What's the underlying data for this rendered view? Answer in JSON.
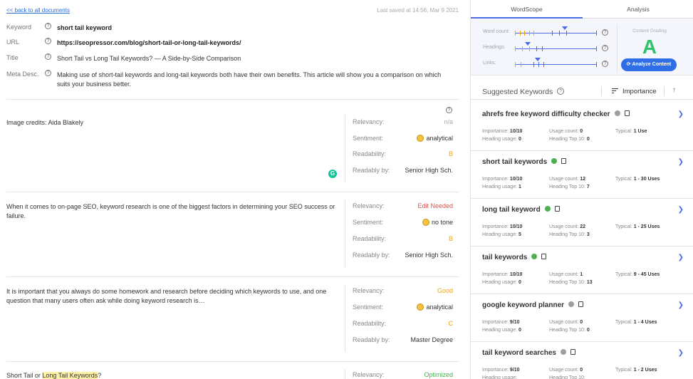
{
  "editor": {
    "back_link": "<< back to all documents",
    "last_saved": "Last saved at 14:56, Mar 9 2021",
    "fields": {
      "keyword": {
        "label": "Keyword",
        "value": "short tail keyword"
      },
      "url": {
        "label": "URL",
        "value": "https://seopressor.com/blog/short-tail-or-long-tail-keywords/"
      },
      "title": {
        "label": "Title",
        "value": "Short Tail vs Long Tail Keywords? — A Side-by-Side Comparison"
      },
      "meta": {
        "label": "Meta Desc.",
        "value": "Making use of short-tail keywords and long-tail keywords both have their own benefits. This article will show you a comparison on which suits your business better."
      }
    },
    "stat_labels": {
      "relevancy": "Relevancy:",
      "sentiment": "Sentiment:",
      "readability": "Readability:",
      "readably_by": "Readably by:"
    },
    "blocks": [
      {
        "text": "Image credits: Aida Blakely",
        "relevancy": "n/a",
        "sentiment": "analytical",
        "readability": "B",
        "readably_by": "Senior High Sch."
      },
      {
        "text": "When it comes to on-page SEO, keyword research is one of the biggest factors in determining your SEO success or failure.",
        "relevancy": "Edit Needed",
        "sentiment": "no tone",
        "readability": "B",
        "readably_by": "Senior High Sch."
      },
      {
        "text": "It is important that you always do some homework and research before deciding which keywords to use, and one question that many users often ask while doing keyword research is…",
        "relevancy": "Good",
        "sentiment": "analytical",
        "readability": "C",
        "readably_by": "Master Degree"
      },
      {
        "text_pre": "Short Tail or ",
        "text_hl": "Long Tail Keywords",
        "text_post": "?",
        "relevancy": "Optimized"
      }
    ],
    "grammarly_badge": "G"
  },
  "sidebar": {
    "tabs": [
      "WordScope",
      "Analysis"
    ],
    "active_tab": "WordScope",
    "metrics": [
      {
        "label": "Word count:"
      },
      {
        "label": "Headings:"
      },
      {
        "label": "Links:"
      }
    ],
    "grading_label": "Content Grading",
    "grade": "A",
    "analyze_button": "Analyze Content",
    "suggested_title": "Suggested Keywords",
    "sort_label": "Importance",
    "stat_labels": {
      "importance": "Importance:",
      "usage": "Usage count:",
      "typical": "Typical:",
      "heading_usage": "Heading usage:",
      "heading_top": "Heading Top 10:"
    },
    "keywords": [
      {
        "name": "ahrefs free keyword difficulty checker",
        "status": "grey",
        "importance": "10/10",
        "usage": "0",
        "typical": "1 Use",
        "heading_usage": "0",
        "heading_top": "0"
      },
      {
        "name": "short tail keywords",
        "status": "green",
        "importance": "10/10",
        "usage": "12",
        "typical": "1 - 30 Uses",
        "heading_usage": "1",
        "heading_top": "7"
      },
      {
        "name": "long tail keyword",
        "status": "green",
        "importance": "10/10",
        "usage": "22",
        "typical": "1 - 25 Uses",
        "heading_usage": "5",
        "heading_top": "3"
      },
      {
        "name": "tail keywords",
        "status": "green",
        "importance": "10/10",
        "usage": "1",
        "typical": "9 - 45 Uses",
        "heading_usage": "0",
        "heading_top": "13"
      },
      {
        "name": "google keyword planner",
        "status": "grey",
        "importance": "9/10",
        "usage": "0",
        "typical": "1 - 4 Uses",
        "heading_usage": "0",
        "heading_top": "0"
      },
      {
        "name": "tail keyword searches",
        "status": "grey",
        "importance": "9/10",
        "usage": "0",
        "typical": "1 - 2 Uses",
        "heading_usage": "",
        "heading_top": ""
      }
    ],
    "colors": {
      "accent": "#4a6de5",
      "grade": "#2ec36b",
      "button": "#2f6ee6",
      "ok": "#4caf50",
      "neutral": "#9e9e9e"
    }
  }
}
